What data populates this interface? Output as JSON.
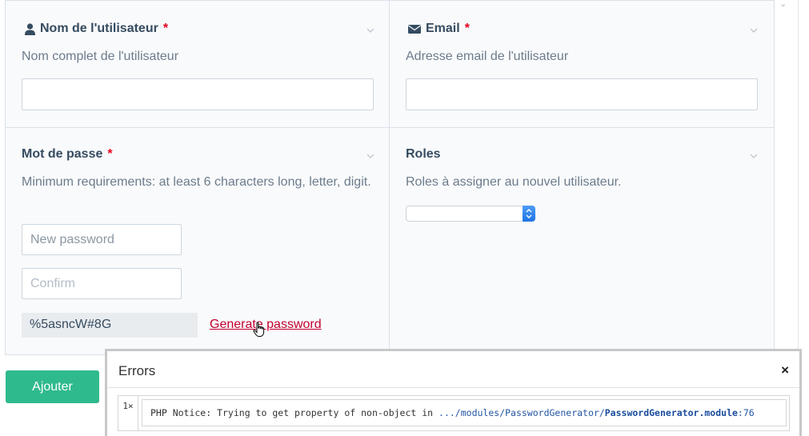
{
  "fields": {
    "username": {
      "label": "Nom de l'utilisateur",
      "required_mark": "*",
      "description": "Nom complet de l'utilisateur",
      "value": "",
      "icon": "user-icon"
    },
    "email": {
      "label": "Email",
      "required_mark": "*",
      "description": "Adresse email de l'utilisateur",
      "value": "",
      "icon": "envelope-icon"
    },
    "password": {
      "label": "Mot de passe",
      "required_mark": "*",
      "description": "Minimum requirements: at least 6 characters long, letter, digit.",
      "new_placeholder": "New password",
      "confirm_placeholder": "Confirm",
      "generated": "%5asncW#8G",
      "generate_link": "Generate password"
    },
    "roles": {
      "label": "Roles",
      "description": "Roles à assigner au nouvel utilisateur.",
      "selected": ""
    }
  },
  "submit_label": "Ajouter",
  "errors": {
    "title": "Errors",
    "close": "×",
    "items": [
      {
        "count": "1×",
        "prefix": "PHP Notice: Trying to get property of non-object in ",
        "path": ".../modules/PasswordGenerator/",
        "file": "PasswordGenerator.module",
        "line": ":76"
      }
    ]
  },
  "colors": {
    "accent": "#2fba8e",
    "required": "#e3001b",
    "link": "#c2002f",
    "text": "#354b60"
  }
}
